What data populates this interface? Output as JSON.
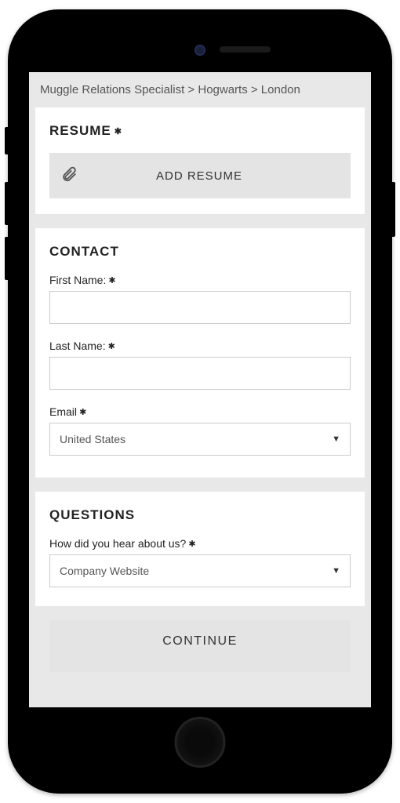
{
  "breadcrumb": "Muggle Relations Specialist > Hogwarts > London",
  "resume": {
    "title": "RESUME",
    "add_button": "ADD RESUME"
  },
  "contact": {
    "title": "CONTACT",
    "first_name_label": "First Name:",
    "first_name_value": "",
    "last_name_label": "Last Name:",
    "last_name_value": "",
    "email_label": "Email",
    "email_country_value": "United States"
  },
  "questions": {
    "title": "QUESTIONS",
    "hear_about_label": "How did you hear about us?",
    "hear_about_value": "Company Website"
  },
  "continue_label": "CONTINUE"
}
